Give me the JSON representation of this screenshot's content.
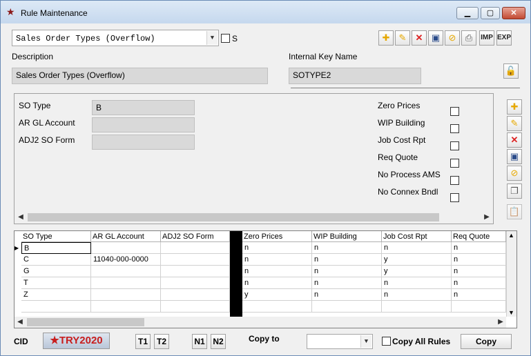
{
  "window": {
    "title": "Rule Maintenance",
    "min_label": "▁",
    "max_label": "▢",
    "close_label": "✕"
  },
  "top": {
    "rule_select": "Sales Order Types (Overflow)",
    "s_label": "S",
    "description_label": "Description",
    "description_value": "Sales Order Types (Overflow)",
    "internal_key_label": "Internal Key Name",
    "internal_key_value": "SOTYPE2"
  },
  "toolbar": {
    "imp_label": "IMP",
    "exp_label": "EXP"
  },
  "form": {
    "so_type_label": "SO Type",
    "so_type_value": "B",
    "ar_gl_label": "AR GL Account",
    "ar_gl_value": "",
    "adj2_label": "ADJ2 SO Form",
    "adj2_value": "",
    "zero_prices_label": "Zero Prices",
    "wip_building_label": "WIP Building",
    "job_cost_rpt_label": "Job Cost Rpt",
    "req_quote_label": "Req Quote",
    "no_process_ams_label": "No Process AMS",
    "no_connex_bndl_label": "No Connex Bndl"
  },
  "grid": {
    "headers": [
      "SO Type",
      "AR GL Account",
      "ADJ2 SO Form",
      "Zero Prices",
      "WIP Building",
      "Job Cost Rpt",
      "Req Quote"
    ],
    "rows": [
      [
        "B",
        "",
        "",
        "n",
        "n",
        "n",
        "n"
      ],
      [
        "C",
        "11040-000-0000",
        "",
        "n",
        "n",
        "y",
        "n"
      ],
      [
        "G",
        "",
        "",
        "n",
        "n",
        "y",
        "n"
      ],
      [
        "T",
        "",
        "",
        "n",
        "n",
        "n",
        "n"
      ],
      [
        "Z",
        "",
        "",
        "y",
        "n",
        "n",
        "n"
      ]
    ]
  },
  "footer": {
    "cid_label": "CID",
    "logo_text": "TRY2020",
    "t1": "T1",
    "t2": "T2",
    "n1": "N1",
    "n2": "N2",
    "copy_to_label": "Copy to",
    "copy_to_value": "",
    "copy_all_rules_label": "Copy All Rules",
    "copy_button": "Copy"
  },
  "colors": {
    "titlebar": "#c5d8ee",
    "field_bg": "#d9d9d9",
    "close_red": "#c24a33",
    "lock_green": "#1a8a1a"
  },
  "icons": [
    "star-app-icon",
    "new-icon",
    "edit-icon",
    "delete-icon",
    "save-icon",
    "cancel-icon",
    "print-icon",
    "unlock-icon",
    "copy-icon",
    "paste-icon"
  ]
}
